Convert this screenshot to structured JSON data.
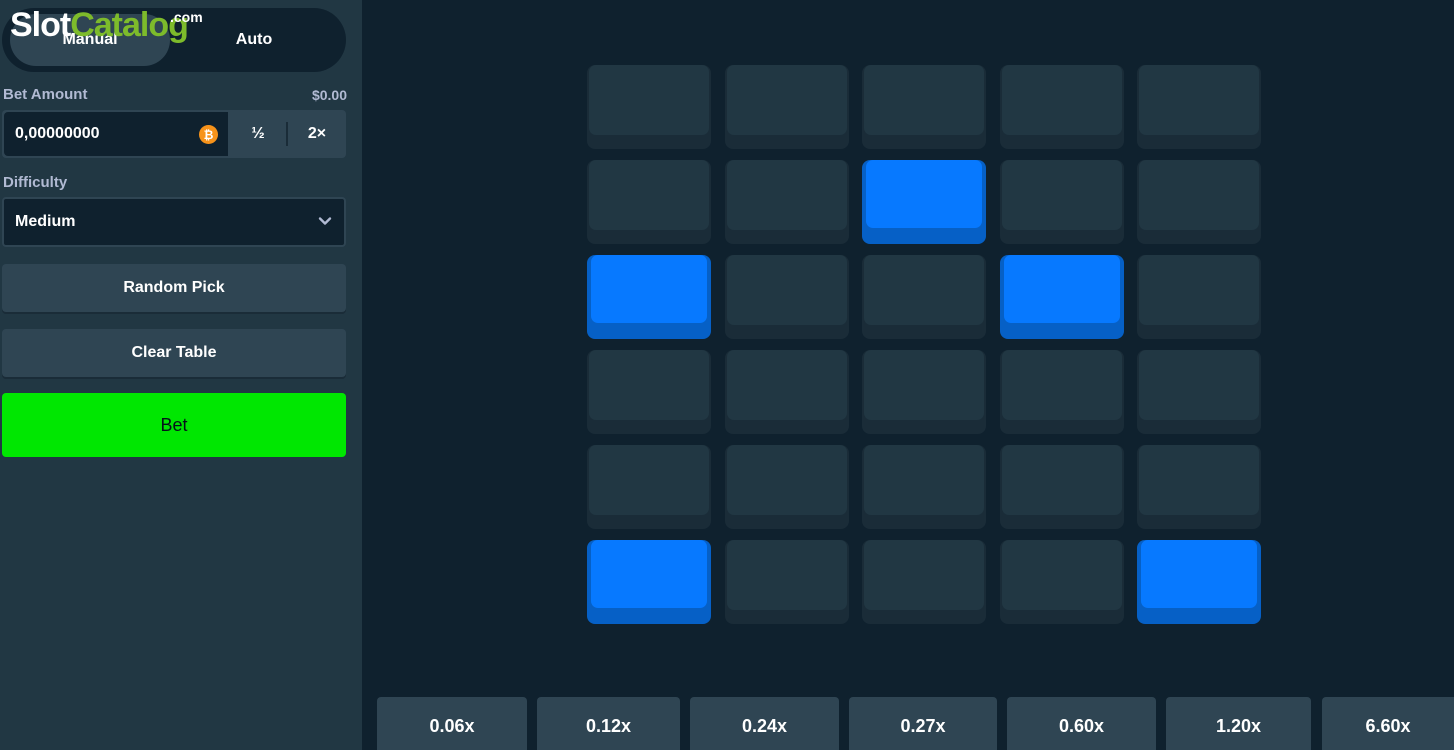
{
  "logo": {
    "part1": "Slot",
    "part2": "Catalog",
    "suffix": ".com"
  },
  "mode_tabs": {
    "manual": "Manual",
    "auto": "Auto"
  },
  "bet": {
    "label": "Bet Amount",
    "usd_value": "$0.00",
    "amount": "0,00000000",
    "coin_icon": "bitcoin-icon",
    "half_label": "½",
    "double_label": "2×"
  },
  "difficulty": {
    "label": "Difficulty",
    "value": "Medium"
  },
  "actions": {
    "random_pick": "Random Pick",
    "clear_table": "Clear Table",
    "bet": "Bet"
  },
  "colors": {
    "background": "#0f212e",
    "sidebar": "#213743",
    "tile": "#213743",
    "tile_selected": "#0779ff",
    "bet_button": "#00e701"
  },
  "grid": {
    "rows": 6,
    "cols": 5,
    "selected": [
      [
        1,
        2
      ],
      [
        2,
        0
      ],
      [
        2,
        3
      ],
      [
        5,
        0
      ],
      [
        5,
        4
      ]
    ]
  },
  "multipliers": [
    "0.06x",
    "0.12x",
    "0.24x",
    "0.27x",
    "0.60x",
    "1.20x",
    "6.60x"
  ]
}
